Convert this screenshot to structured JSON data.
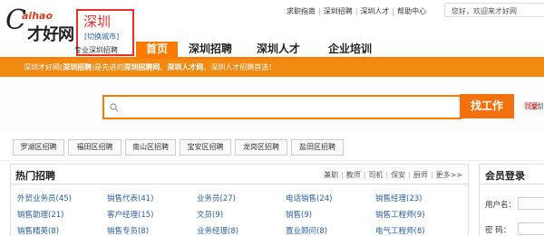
{
  "header": {
    "logo_text": "C",
    "logo_mark": "aihao",
    "logo_cn": "才好网",
    "city": "深圳",
    "city_switch": "[切换城市]",
    "site_tag": "专业深圳招聘",
    "top_links": [
      "求职指南",
      "深圳招聘",
      "深圳人才",
      "帮助中心"
    ],
    "greeting": "您好，欢迎来才好网",
    "nav_tabs": [
      "首页",
      "深圳招聘",
      "深圳人才",
      "企业培训"
    ]
  },
  "banner": {
    "p1": "深圳才好网(",
    "b1": "深圳招聘",
    "p2": ")是先进的",
    "b2": "深圳招聘网",
    "p3": "、",
    "b3": "深圳人才网",
    "p4": "，深圳人才招聘首选！"
  },
  "search": {
    "placeholder": "",
    "city": "深圳",
    "button": "找工作",
    "post_link": "我要"
  },
  "districts": [
    "罗湖区招聘",
    "福田区招聘",
    "南山区招聘",
    "宝安区招聘",
    "龙岗区招聘",
    "盐田区招聘"
  ],
  "hot_jobs": {
    "title": "热门招聘",
    "links": [
      "兼职",
      "教师",
      "司机",
      "保安",
      "厨师",
      "更多>>"
    ],
    "items": [
      "外贸业务员(45)",
      "销售代表(41)",
      "业务员(27)",
      "电话销售(24)",
      "销售经理(23)",
      "销售助理(21)",
      "客户经理(15)",
      "文员(9)",
      "销售(9)",
      "销售工程师(9)",
      "销售精英(8)",
      "销售专员(8)",
      "业务经理(8)",
      "置业顾问(8)",
      "电气工程师(8)"
    ]
  },
  "login": {
    "title": "会员登录",
    "username_label": "用户名：",
    "password_label": "密  码："
  },
  "colors": {
    "accent": "#ff7a00",
    "banner": "#f08a12",
    "city_red": "#e3322b",
    "link_blue": "#2a5fa8"
  }
}
